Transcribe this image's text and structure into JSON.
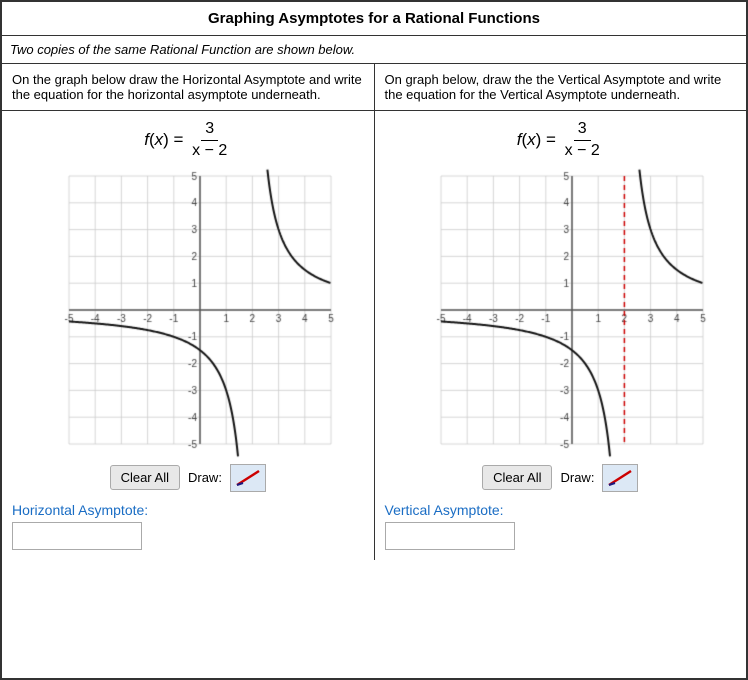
{
  "title": "Graphing Asymptotes for a Rational Functions",
  "subtitle": "Two copies of the same Rational Function are shown below.",
  "left_instruction": "On the graph below draw the Horizontal Asymptote and write the equation for the horizontal asymptote underneath.",
  "right_instruction": "On graph below, draw the the Vertical Asymptote and write the equation for the Vertical Asymptote underneath.",
  "func_label": "f(x) =",
  "func_numerator": "3",
  "func_denominator": "x − 2",
  "clear_btn_label": "Clear All",
  "draw_label": "Draw:",
  "left_asymptote_label": "Horizontal Asymptote:",
  "right_asymptote_label": "Vertical Asymptote:",
  "axis": {
    "x_min": -5,
    "x_max": 5,
    "y_min": -5,
    "y_max": 5
  },
  "colors": {
    "grid": "#cccccc",
    "axis": "#444444",
    "curve": "#111111",
    "swatch_bg": "#dce8f5",
    "pen_red": "#cc0000",
    "pen_blue": "#0000cc"
  }
}
